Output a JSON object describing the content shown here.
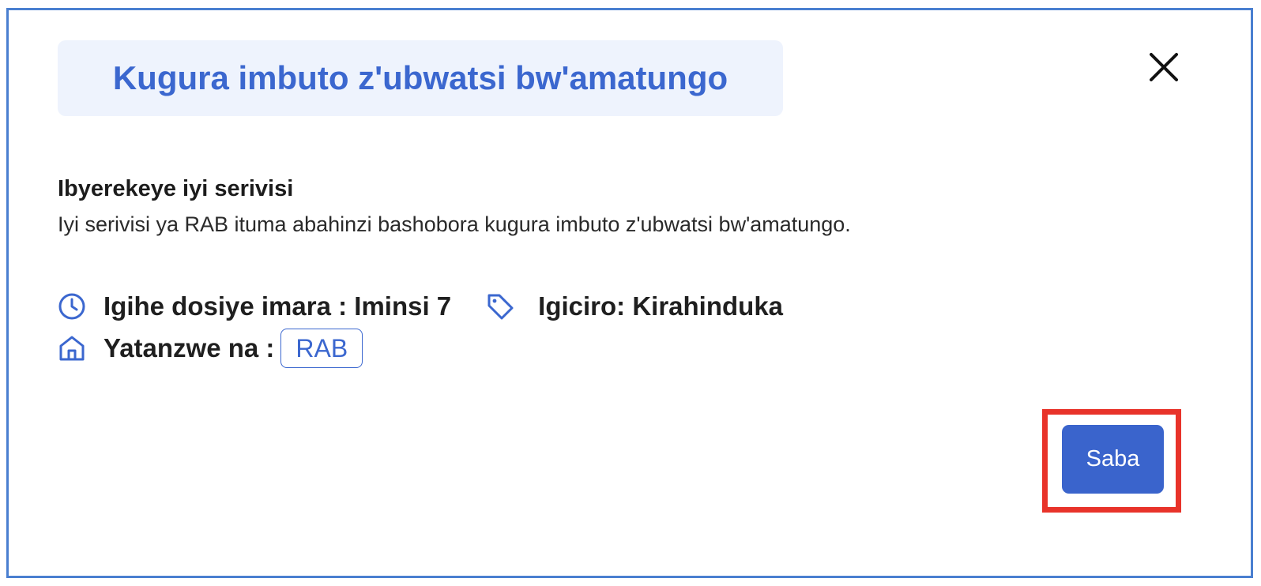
{
  "modal": {
    "title": "Kugura imbuto z'ubwatsi bw'amatungo",
    "close_icon": "close-icon"
  },
  "about": {
    "heading": "Ibyerekeye iyi serivisi",
    "body": "Iyi serivisi ya RAB ituma abahinzi bashobora kugura imbuto z'ubwatsi bw'amatungo."
  },
  "meta": {
    "processing_time": "Igihe dosiye imara : Iminsi 7",
    "processing_icon": "clock-icon",
    "price": "Igiciro: Kirahinduka",
    "price_icon": "tag-icon",
    "provider_label": "Yatanzwe na :",
    "provider_icon": "home-icon",
    "provider_badge": "RAB"
  },
  "actions": {
    "request_label": "Saba"
  },
  "colors": {
    "accent": "#3b67cf",
    "title_background": "#eef3fd",
    "frame_border": "#4a7fd0",
    "highlight": "#e8332a"
  }
}
